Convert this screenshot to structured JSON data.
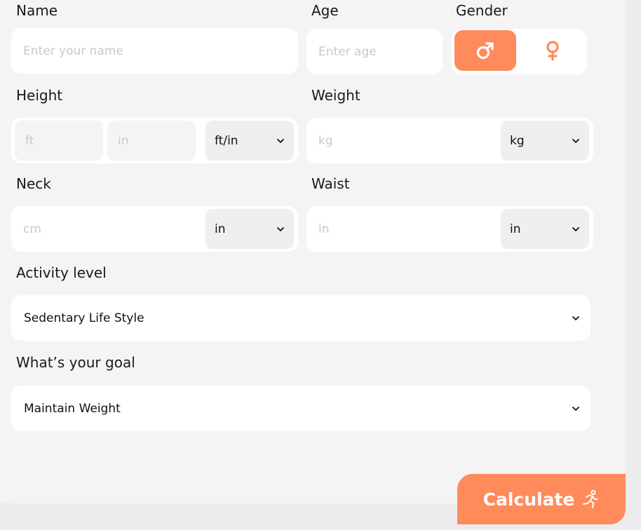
{
  "colors": {
    "accent": "#ff8a5c",
    "panel_bg": "#f4f4f4",
    "field_bg": "#ffffff",
    "placeholder": "#c9c9c9"
  },
  "form": {
    "name": {
      "label": "Name",
      "placeholder": "Enter your name",
      "value": ""
    },
    "age": {
      "label": "Age",
      "placeholder": "Enter age",
      "value": ""
    },
    "gender": {
      "label": "Gender",
      "options": [
        {
          "id": "male",
          "icon": "male-symbol-icon",
          "selected": true
        },
        {
          "id": "female",
          "icon": "female-symbol-icon",
          "selected": false
        }
      ]
    },
    "height": {
      "label": "Height",
      "ft_placeholder": "ft",
      "in_placeholder": "in",
      "unit": "ft/in"
    },
    "weight": {
      "label": "Weight",
      "placeholder": "kg",
      "unit": "kg"
    },
    "neck": {
      "label": "Neck",
      "placeholder": "cm",
      "unit": "in"
    },
    "waist": {
      "label": "Waist",
      "placeholder": "in",
      "unit": "in"
    },
    "activity": {
      "label": "Activity level",
      "selected": "Sedentary Life Style"
    },
    "goal": {
      "label": "What’s your goal",
      "selected": "Maintain Weight"
    }
  },
  "actions": {
    "calculate_label": "Calculate",
    "calculate_icon": "running-person-icon"
  }
}
